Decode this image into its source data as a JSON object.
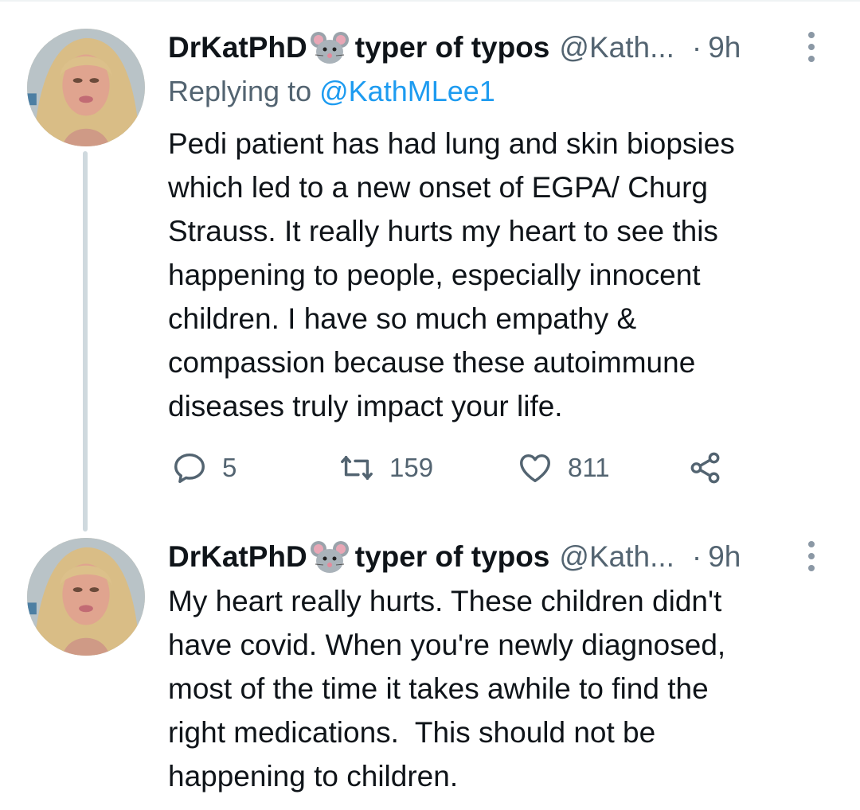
{
  "tweets": [
    {
      "display_name": "DrKatPhD",
      "emoji": "mouse-emoji",
      "name_suffix": "typer of typos",
      "handle": "@Kath...",
      "dot": "·",
      "time": "9h",
      "replying_prefix": "Replying to",
      "replying_to": "@KathMLee1",
      "text": "Pedi patient has had lung and skin biopsies\nwhich led to a new onset of EGPA/ Churg\nStrauss. It really hurts my heart to see this\nhappening to people, especially innocent\nchildren. I have so much empathy &\ncompassion because these autoimmune\ndiseases truly impact your life.",
      "actions": {
        "reply_count": "5",
        "retweet_count": "159",
        "like_count": "811"
      }
    },
    {
      "display_name": "DrKatPhD",
      "emoji": "mouse-emoji",
      "name_suffix": "typer of typos",
      "handle": "@Kath...",
      "dot": "·",
      "time": "9h",
      "text": "My heart really hurts. These children didn't\nhave covid. When you're newly diagnosed,\nmost of the time it takes awhile to find the\nright medications.  This should not be\nhappening to children."
    }
  ],
  "colors": {
    "text": "#0f1419",
    "secondary": "#536471",
    "link": "#1d9bf0",
    "thread_line": "#cfd9de"
  }
}
